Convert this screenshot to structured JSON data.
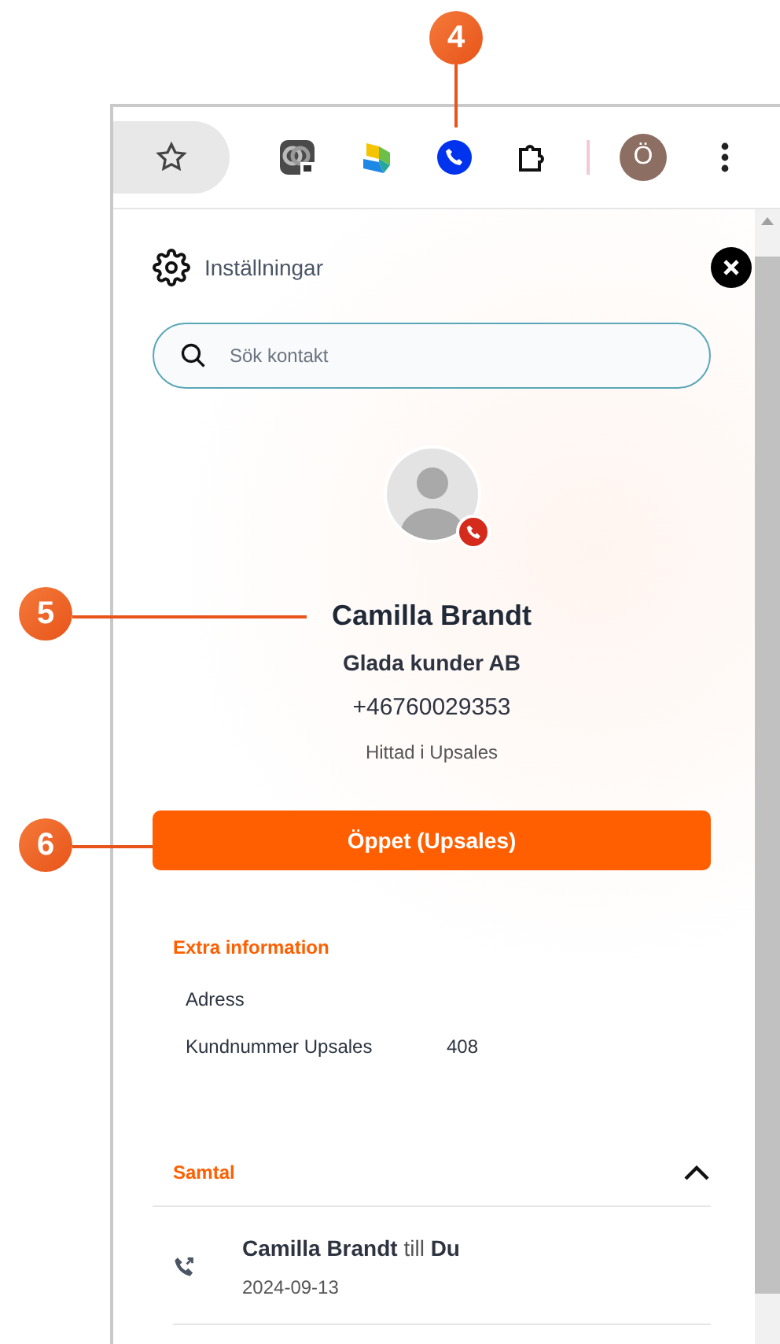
{
  "annotations": [
    {
      "number": "4"
    },
    {
      "number": "5"
    },
    {
      "number": "6"
    }
  ],
  "toolbar": {
    "avatar_letter": "Ö"
  },
  "panel": {
    "settings_label": "Inställningar",
    "search": {
      "placeholder": "Sök kontakt"
    },
    "contact": {
      "name": "Camilla Brandt",
      "company": "Glada kunder AB",
      "phone": "+46760029353",
      "source": "Hittad i Upsales"
    },
    "open_button": "Öppet (Upsales)",
    "extra": {
      "title": "Extra information",
      "rows": [
        {
          "label": "Adress"
        },
        {
          "label": "Kundnummer Upsales",
          "value": "408"
        }
      ]
    },
    "calls": {
      "title": "Samtal",
      "expanded": true,
      "items": [
        {
          "text": "**Camilla Brandt** till **Du**",
          "date": "2024-09-13"
        }
      ]
    }
  }
}
